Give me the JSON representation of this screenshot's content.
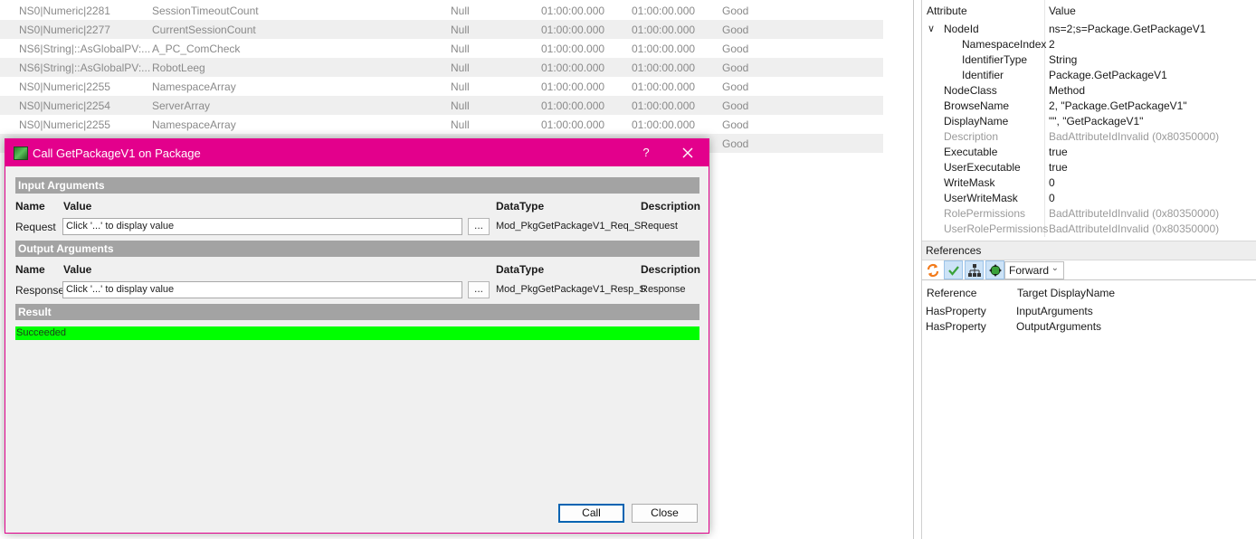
{
  "grid": {
    "rows": [
      {
        "node": "NS0|Numeric|2281",
        "name": "SessionTimeoutCount",
        "value": "Null",
        "source_ts": "01:00:00.000",
        "server_ts": "01:00:00.000",
        "status": "Good"
      },
      {
        "node": "NS0|Numeric|2277",
        "name": "CurrentSessionCount",
        "value": "Null",
        "source_ts": "01:00:00.000",
        "server_ts": "01:00:00.000",
        "status": "Good"
      },
      {
        "node": "NS6|String|::AsGlobalPV:...",
        "name": "A_PC_ComCheck",
        "value": "Null",
        "source_ts": "01:00:00.000",
        "server_ts": "01:00:00.000",
        "status": "Good"
      },
      {
        "node": "NS6|String|::AsGlobalPV:...",
        "name": "RobotLeeg",
        "value": "Null",
        "source_ts": "01:00:00.000",
        "server_ts": "01:00:00.000",
        "status": "Good"
      },
      {
        "node": "NS0|Numeric|2255",
        "name": "NamespaceArray",
        "value": "Null",
        "source_ts": "01:00:00.000",
        "server_ts": "01:00:00.000",
        "status": "Good"
      },
      {
        "node": "NS0|Numeric|2254",
        "name": "ServerArray",
        "value": "Null",
        "source_ts": "01:00:00.000",
        "server_ts": "01:00:00.000",
        "status": "Good"
      },
      {
        "node": "NS0|Numeric|2255",
        "name": "NamespaceArray",
        "value": "Null",
        "source_ts": "01:00:00.000",
        "server_ts": "01:00:00.000",
        "status": "Good"
      },
      {
        "node": "",
        "name": "",
        "value": "",
        "source_ts": "",
        "server_ts": "",
        "status": "Good"
      }
    ]
  },
  "attributes": {
    "header": {
      "attribute": "Attribute",
      "value": "Value"
    },
    "rows": [
      {
        "name": "NodeId",
        "value": "ns=2;s=Package.GetPackageV1",
        "level": 0,
        "expanded": true,
        "dim": false
      },
      {
        "name": "NamespaceIndex",
        "value": "2",
        "level": 1,
        "dim": false
      },
      {
        "name": "IdentifierType",
        "value": "String",
        "level": 1,
        "dim": false
      },
      {
        "name": "Identifier",
        "value": "Package.GetPackageV1",
        "level": 1,
        "dim": false
      },
      {
        "name": "NodeClass",
        "value": "Method",
        "level": 0,
        "dim": false
      },
      {
        "name": "BrowseName",
        "value": "2, \"Package.GetPackageV1\"",
        "level": 0,
        "dim": false
      },
      {
        "name": "DisplayName",
        "value": "\"\", \"GetPackageV1\"",
        "level": 0,
        "dim": false
      },
      {
        "name": "Description",
        "value": "BadAttributeIdInvalid (0x80350000)",
        "level": 0,
        "dim": true
      },
      {
        "name": "Executable",
        "value": "true",
        "level": 0,
        "dim": false
      },
      {
        "name": "UserExecutable",
        "value": "true",
        "level": 0,
        "dim": false
      },
      {
        "name": "WriteMask",
        "value": "0",
        "level": 0,
        "dim": false
      },
      {
        "name": "UserWriteMask",
        "value": "0",
        "level": 0,
        "dim": false
      },
      {
        "name": "RolePermissions",
        "value": "BadAttributeIdInvalid (0x80350000)",
        "level": 0,
        "dim": true
      },
      {
        "name": "UserRolePermissions",
        "value": "BadAttributeIdInvalid (0x80350000)",
        "level": 0,
        "dim": true
      }
    ],
    "expander_glyph": "∨"
  },
  "references": {
    "title": "References",
    "direction": "Forward",
    "header": {
      "reference": "Reference",
      "target": "Target DisplayName"
    },
    "rows": [
      {
        "reference": "HasProperty",
        "target": "InputArguments"
      },
      {
        "reference": "HasProperty",
        "target": "OutputArguments"
      }
    ],
    "icons": [
      "refresh-icon",
      "checkmark-icon",
      "hierarchy-icon",
      "move-icon"
    ],
    "colors": {
      "refresh": "#f27a1a",
      "check": "#3aa23a",
      "toggle_on": "#cde3f7"
    }
  },
  "dialog": {
    "title": "Call GetPackageV1 on Package",
    "help": "?",
    "input_section": "Input Arguments",
    "output_section": "Output Arguments",
    "result_section": "Result",
    "columns": {
      "name": "Name",
      "value": "Value",
      "datatype": "DataType",
      "description": "Description"
    },
    "input_arg": {
      "name": "Request",
      "value": "Click '...' to display value",
      "datatype": "Mod_PkgGetPackageV1_Req_S",
      "description": "Request"
    },
    "output_arg": {
      "name": "Response",
      "value": "Click '...' to display value",
      "datatype": "Mod_PkgGetPackageV1_Resp_S",
      "description": "Response"
    },
    "ellipsis": "...",
    "result_text": "Succeeded",
    "call_label": "Call",
    "close_label": "Close",
    "colors": {
      "titlebar": "#e3008c",
      "result": "#00ff00",
      "section": "#a3a3a3"
    }
  }
}
